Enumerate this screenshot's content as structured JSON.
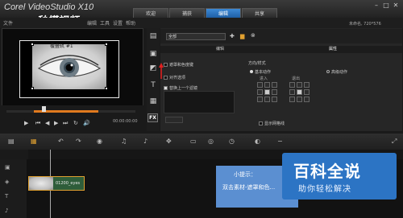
{
  "app": {
    "title": "Corel VideoStudio X10",
    "watermark_overlay": "秒懂视频"
  },
  "menu": {
    "items": [
      "文件",
      "编辑",
      "工具",
      "设置",
      "帮助"
    ]
  },
  "workspace_tabs": [
    {
      "label": "欢迎",
      "active": false
    },
    {
      "label": "捕获",
      "active": false
    },
    {
      "label": "编辑",
      "active": true
    },
    {
      "label": "共享",
      "active": false
    }
  ],
  "project_info": "未命名, 720*576",
  "window_controls": {
    "minimize": "–",
    "maximize": "□",
    "close": "✕"
  },
  "preview": {
    "clip_label": "覆叠轨 #1",
    "timecode": "00:00:00:00"
  },
  "transport": {
    "buttons": [
      "▶",
      "⏮",
      "◀",
      "▶",
      "⏭",
      "↻",
      "🔊"
    ]
  },
  "options": {
    "dropdown_value": "全部",
    "tabs": [
      "编辑",
      "属性"
    ],
    "active_tab": "属性",
    "checkboxes": [
      {
        "label": "遮罩和色度键",
        "checked": false
      },
      {
        "label": "对齐选项",
        "checked": false
      },
      {
        "label": "替换上一个滤镜",
        "checked": true
      }
    ],
    "direction_label": "方向/样式",
    "enter_label": "进入",
    "exit_label": "退出",
    "basic_motion_label": "基本动作",
    "advanced_motion_label": "高级动作",
    "show_grid_label": "显示网格线",
    "fx_label": "FX"
  },
  "tip": {
    "title": "小提示：",
    "body": "双击素材-遮罩和色..."
  },
  "clip": {
    "name": "01200_eyes"
  },
  "baike": {
    "title": "百科全说",
    "subtitle": "助你轻松解决"
  },
  "colors": {
    "accent_tab": "#2a78c8",
    "clip_border": "#e0a030",
    "tip_bg": "#5b8fd1",
    "baike_bg": "#2c74c4"
  }
}
